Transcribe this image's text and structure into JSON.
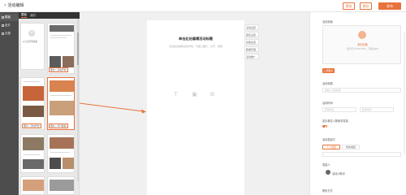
{
  "header": {
    "back_label": "活动编辑",
    "preview_label": "预览",
    "save_label": "保存",
    "publish_label": "发布"
  },
  "leftbar": {
    "items": [
      {
        "label": "模板",
        "icon": "grid-icon"
      },
      {
        "label": "组件",
        "icon": "component-icon"
      },
      {
        "label": "设置",
        "icon": "settings-icon"
      }
    ]
  },
  "library": {
    "tabs": [
      "模板",
      "我的"
    ],
    "blank_label": "从空白开始编辑",
    "captions": [
      "图文 | 活动开始",
      "图文 | 活动开始",
      "图文 | 平行模版"
    ]
  },
  "canvas": {
    "title": "单击此处编辑活动标题",
    "subtitle": "点击此处编辑活动详情，可插入图片、文字、视频",
    "side_menu": [
      "活动设置",
      "报名设置",
      "投票设置",
      "数据管理",
      "活动推广"
    ]
  },
  "panel": {
    "cover_label": "活动封面",
    "upload_main": "添加封面",
    "upload_hint": "建议尺寸750*420，不超过2M",
    "upload_button": "上传图片",
    "title_label": "活动标题",
    "title_placeholder": "请输入活动标题",
    "time_label": "活动时间",
    "time_start": "开始时间",
    "time_end": "结束时间",
    "switch_label": "显示报名人数和浏览量",
    "organizer_label": "活动发起方",
    "radio_options": [
      "个人发起",
      "机构发起"
    ],
    "person_label": "发起人",
    "person_name": "活动小助手",
    "contact_label": "联系方式"
  },
  "colors": {
    "accent": "#e8723d",
    "sidebar": "#4d4d4d"
  }
}
